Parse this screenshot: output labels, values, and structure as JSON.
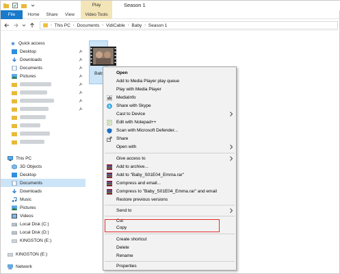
{
  "window": {
    "title": "Season 1",
    "contextual_tab_group": "Play"
  },
  "ribbon": {
    "tabs": [
      "File",
      "Home",
      "Share",
      "View",
      "Video Tools"
    ]
  },
  "address": {
    "breadcrumbs": [
      "This PC",
      "Documents",
      "VidiCable",
      "Baby",
      "Season 1"
    ]
  },
  "nav": {
    "quick_access": "Quick access",
    "pinned": [
      "Desktop",
      "Downloads",
      "Documents",
      "Pictures"
    ],
    "this_pc": "This PC",
    "this_pc_items": [
      "3D Objects",
      "Desktop",
      "Documents",
      "Downloads",
      "Music",
      "Pictures",
      "Videos",
      "Local Disk (C:)",
      "Local Disk (D:)",
      "KINGSTON (E:)"
    ],
    "kingston_root": "KINGSTON (E:)",
    "network": "Network",
    "selected": "Documents"
  },
  "file": {
    "label": "Baby"
  },
  "context_menu": {
    "items": [
      {
        "label": "Open",
        "bold": true
      },
      {
        "label": "Add to Media Player play queue"
      },
      {
        "label": "Play with Media Player"
      },
      {
        "label": "MediaInfo",
        "icon": "mediainfo-icon"
      },
      {
        "label": "Share with Skype",
        "icon": "skype-icon"
      },
      {
        "label": "Cast to Device",
        "submenu": true
      },
      {
        "label": "Edit with Notepad++",
        "icon": "notepadpp-icon"
      },
      {
        "label": "Scan with Microsoft Defender...",
        "icon": "defender-icon"
      },
      {
        "label": "Share",
        "icon": "share-icon"
      },
      {
        "label": "Open with",
        "submenu": true
      },
      {
        "label": "Give access to",
        "submenu": true
      },
      {
        "label": "Add to archive...",
        "icon": "winrar-icon"
      },
      {
        "label": "Add to \"Baby_S01E04_Emma.rar\"",
        "icon": "winrar-icon"
      },
      {
        "label": "Compress and email...",
        "icon": "winrar-icon"
      },
      {
        "label": "Compress to \"Baby_S01E04_Emma.rar\" and email",
        "icon": "winrar-icon"
      },
      {
        "label": "Restore previous versions"
      },
      {
        "label": "Send to",
        "submenu": true
      },
      {
        "label": "Cut"
      },
      {
        "label": "Copy",
        "highlighted": true
      },
      {
        "label": "Create shortcut"
      },
      {
        "label": "Delete"
      },
      {
        "label": "Rename"
      },
      {
        "label": "Properties"
      }
    ]
  },
  "colors": {
    "file_tab": "#1979ca",
    "contextual_tab": "#f3e5b7",
    "selection": "#cce4f7",
    "highlight_border": "#e02b2b",
    "menu_bg": "#f2f2f2"
  }
}
